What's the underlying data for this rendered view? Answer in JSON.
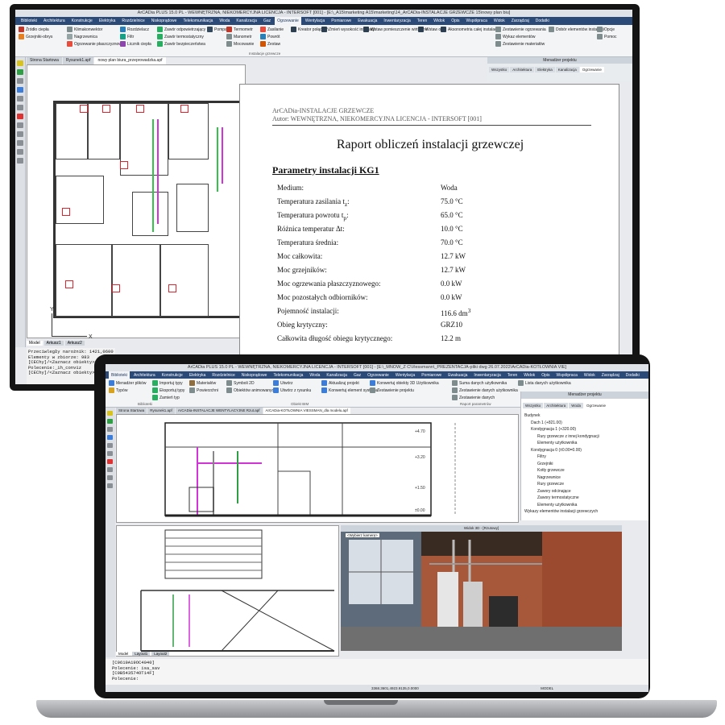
{
  "monitor": {
    "app_title": "ArCADia PLUS 15.0 PL - WEWNĘTRZNA, NIEKOMERCYJNA LICENCJA - INTERSOFT [001] - [E:\\_A15\\marketing A15\\marketing\\14_ArCADia-INSTALACJE GRZEWCZE 15\\nowy plan biu]",
    "ribbon_tabs": [
      "Biblioteki",
      "Architektura",
      "Konstrukcje",
      "Elektryka",
      "Rozdzielnice",
      "Niskoprądowe",
      "Telekomunikacja",
      "Woda",
      "Kanalizacja",
      "Gaz",
      "Ogrzewanie",
      "Wentylacja",
      "Pomiarowe",
      "Ewakuacja",
      "Inwentaryzacja",
      "Teren",
      "Widok",
      "Opis",
      "Współpraca",
      "Widok",
      "Zarządzaj",
      "Dodatki"
    ],
    "active_tab": "Ogrzewanie",
    "ribbon_buttons": [
      "Źródło ciepła",
      "Grzejniki-obrys",
      "Klimakonwektor",
      "Nagrzewnica",
      "Ogrzewanie płaszczyznowe",
      "Rozdzielacz",
      "Filtr",
      "Licznik ciepła",
      "Zawór odpowietrzający",
      "Zawór termostatyczny",
      "Zawór bezpieczeństwa",
      "Pompa",
      "Termometr",
      "Manometr",
      "Mocowanie",
      "Zasilanie",
      "Powrót",
      "Zestaw",
      "Kreator połączeń",
      "Zmień wysokość instalacji",
      "Wstaw pomieszczenie wirtualne",
      "Wstaw opis",
      "Aksonometria całej instalacji",
      "Zestawienie ogrzewania",
      "Wykaz elementów",
      "Zestawienie materiałów",
      "Dobór elementów instalacji",
      "Opcje",
      "Pomoc"
    ],
    "ribbon_group_label": "Instalacje grzewcze",
    "doc_tabs": [
      "Strona Startowa",
      "Rysunek1.apf",
      "nowy plan biura_przeprowadzka.apf"
    ],
    "manager_title": "Menadżer projektu",
    "manager_tabs": [
      "Wszystko",
      "Architektura",
      "Elektryka",
      "Kanalizacja",
      "Ogrzewanie"
    ],
    "axis_y": "Y",
    "axis_x": "X",
    "layout_tabs": [
      "Model",
      "Arkusz1",
      "Arkusz2"
    ],
    "command_lines": [
      "Przeciwległy narożnik: 1421,0600",
      "Elementy w zbiorze: 983",
      "[CEChy]/<Zaznacz obiekty>:",
      "Polecenie:_ih_conviz",
      "[CEChy]/<Zaznacz obiekty>"
    ]
  },
  "report": {
    "header_line1": "ArCADia-INSTALACJE GRZEWCZE",
    "header_line2": "Autor: WEWNĘTRZNA, NIEKOMERCYJNA LICENCJA - INTERSOFT [001]",
    "title": "Raport obliczeń instalacji grzewczej",
    "section": "Parametry instalacji KG1",
    "params": [
      {
        "label": "Medium:",
        "value": "Woda"
      },
      {
        "label": "Temperatura zasilania t",
        "sub": "z",
        "label_end": ":",
        "value": "75.0 °C"
      },
      {
        "label": "Temperatura powrotu t",
        "sub": "p",
        "label_end": ":",
        "value": "65.0 °C"
      },
      {
        "label": "Różnica temperatur Δt:",
        "value": "10.0 °C"
      },
      {
        "label": "Temperatura średnia:",
        "value": "70.0 °C"
      },
      {
        "label": "Moc całkowita:",
        "value": "12.7 kW"
      },
      {
        "label": "Moc grzejników:",
        "value": "12.7 kW"
      },
      {
        "label": "Moc ogrzewania płaszczyznowego:",
        "value": "0.0 kW"
      },
      {
        "label": "Moc pozostałych odbiorników:",
        "value": "0.0 kW"
      },
      {
        "label": "Pojemność instalacji:",
        "value": "116.6 dm",
        "sup": "3"
      },
      {
        "label": "Obieg krytyczny:",
        "value": "GRZ10"
      },
      {
        "label": "Całkowita długość obiegu krytycznego:",
        "value": "12.2 m"
      }
    ]
  },
  "laptop": {
    "app_title": "ArCADia PLUS 15.0 PL - WEWNĘTRZNA, NIEKOMERCYJNA LICENCJA - INTERSOFT [001] - [E:\\_MNOW_Z C\\Viessmann\\_PREZENTACJA-pliki dwg 26.07.2022\\ArCADia-KOTŁOWNIA VIE]",
    "ribbon_tabs": [
      "Biblioteki",
      "Architektura",
      "Konstrukcje",
      "Elektryka",
      "Rozdzielnice",
      "Niskoprądowe",
      "Telekomunikacja",
      "Woda",
      "Kanalizacja",
      "Gaz",
      "Ogrzewanie",
      "Wentylacja",
      "Pomiarowe",
      "Ewakuacja",
      "Inwentaryzacja",
      "Teren",
      "Widok",
      "Opis",
      "Współpraca",
      "Widok",
      "Zarządzaj",
      "Dodatki"
    ],
    "active_tab": "Biblioteki",
    "ribbon_buttons": [
      "Menadżer plików",
      "Typów",
      "Importuj typy",
      "Eksportuj typy",
      "Zamień typ",
      "Materiałów",
      "Powierzchni",
      "Symboli 2D",
      "Obiektów animowanych",
      "Utwórz",
      "Utwórz z rysunku",
      "Aktualizuj projekt",
      "Konwertuj element systemu",
      "Konwertuj obiekty 3D Użytkownika",
      "Zestawienie projektu",
      "Suma danych użytkownika",
      "Zestawienie danych użytkownika",
      "Zestawienie danych",
      "Lista danych użytkownika"
    ],
    "ribbon_group_labels": [
      "Biblioteki",
      "Obiekt BIM",
      "Raport parametrów"
    ],
    "doc_tabs": [
      "Strona Startowa",
      "Rysunek1.apf",
      "ArCADia-INSTALACJE WENTYLACYJNE Rzut.apf",
      "ArCADia-KOTŁOWNIA VIESSMAN_dla modelu.apf"
    ],
    "view3d_title": "Widok 3D - [Rzutowy]",
    "camera_label": "<Wybierz kamerę>",
    "manager_title": "Menadżer projektu",
    "manager_tabs": [
      "Wszystko",
      "Architektura",
      "Woda",
      "Ogrzewanie"
    ],
    "tree": [
      "Budynek",
      "Dach 1 (+821.00)",
      "Kondygnacja 1 (+320.00)",
      "Rury grzewcze z innej kondygnacji",
      "Elementy użytkownika",
      "Kondygnacja 0 (±0.00=0.00)",
      "Filtry",
      "Grzejniki",
      "Kotły grzewcze",
      "Nagrzewnice",
      "Rury grzewcze",
      "Zawory odcinające",
      "Zawory termostatyczne",
      "Elementy użytkownika",
      "Wykazy elementów instalacji grzewczych"
    ],
    "layout_tabs": [
      "Model",
      "Layout1",
      "Layout2"
    ],
    "command_lines": [
      "[C9619A19OC4040]",
      "Polecenie: isa_sav",
      "[C9B543574OT14F]",
      "Polecenie:"
    ],
    "status_coords": "3368.3601,4923.9135,0.0000",
    "status_right": "MODEL",
    "elev_labels": [
      "+4.70",
      "+3.20",
      "+1.50",
      "±0.00"
    ]
  }
}
